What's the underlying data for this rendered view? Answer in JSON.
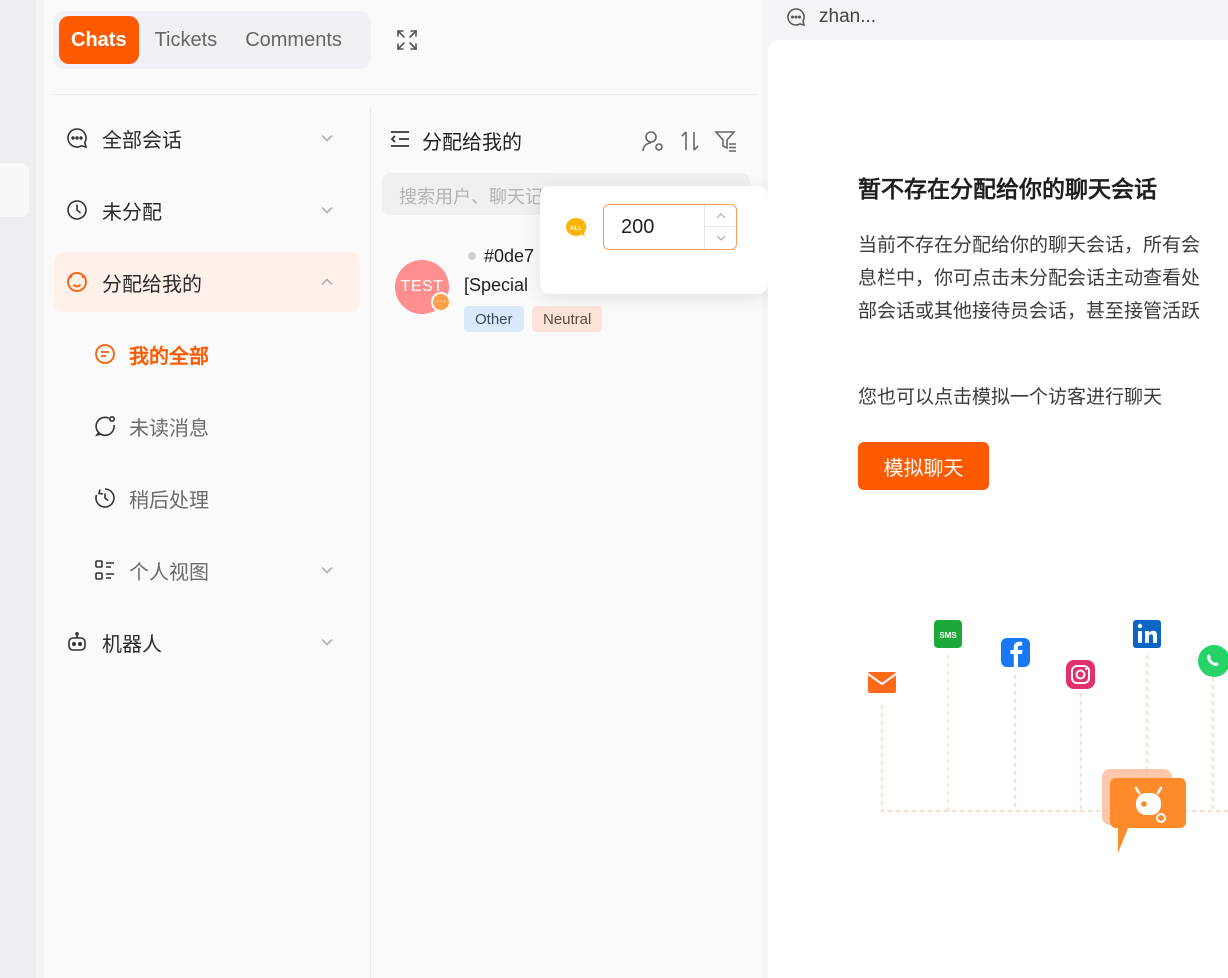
{
  "tabs": [
    {
      "label": "Chats",
      "active": true
    },
    {
      "label": "Tickets",
      "active": false
    },
    {
      "label": "Comments",
      "active": false
    }
  ],
  "nav": {
    "all_chats": "全部会话",
    "unassigned": "未分配",
    "assigned_to_me": "分配给我的",
    "sub": {
      "my_all": "我的全部",
      "unread": "未读消息",
      "later": "稍后处理",
      "personal_view": "个人视图"
    },
    "bot": "机器人"
  },
  "list": {
    "title": "分配给我的",
    "search_placeholder": "搜索用户、聊天记",
    "conversation": {
      "avatar_text": "TEST",
      "id": "#0de7",
      "message": "[Special",
      "tags": [
        "Other",
        "Neutral"
      ]
    }
  },
  "popover": {
    "value": "200"
  },
  "right": {
    "agent_name": "zhan...",
    "empty_title": "暂不存在分配给你的聊天会话",
    "empty_desc_lines": [
      "当前不存在分配给你的聊天会话，所有会",
      "息栏中，你可点击未分配会话主动查看处",
      "部会话或其他接待员会话，甚至接管活跃"
    ],
    "hint": "您也可以点击模拟一个访客进行聊天",
    "simulate_button": "模拟聊天"
  },
  "colors": {
    "accent": "#ff5a00",
    "active_bg": "#fff1ea"
  }
}
